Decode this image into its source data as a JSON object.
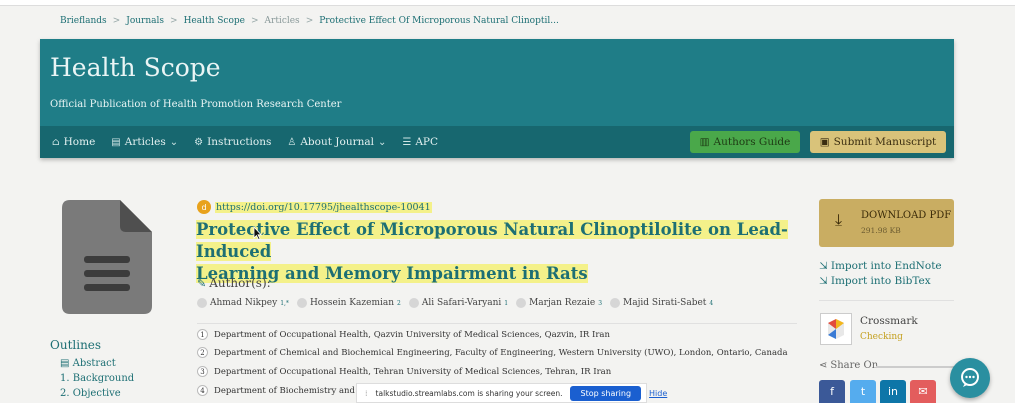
{
  "breadcrumb": [
    {
      "label": "Brieflands",
      "muted": false
    },
    {
      "label": "Journals",
      "muted": false
    },
    {
      "label": "Health Scope",
      "muted": false
    },
    {
      "label": "Articles",
      "muted": true
    },
    {
      "label": "Protective Effect Of Microporous Natural Clinoptil...",
      "muted": false
    }
  ],
  "breadcrumb_sep": ">",
  "journal": {
    "title": "Health Scope",
    "subtitle": "Official Publication of Health Promotion Research Center"
  },
  "nav": {
    "items": [
      {
        "label": "Home",
        "icon": "home-icon",
        "glyph": "⌂"
      },
      {
        "label": "Articles",
        "icon": "book-icon",
        "glyph": "▤",
        "dropdown": true
      },
      {
        "label": "Instructions",
        "icon": "gears-icon",
        "glyph": "⚙"
      },
      {
        "label": "About Journal",
        "icon": "person-icon",
        "glyph": "♙",
        "dropdown": true
      },
      {
        "label": "APC",
        "icon": "list-icon",
        "glyph": "☰"
      }
    ],
    "authors_guide": "Authors Guide",
    "submit_manuscript": "Submit Manuscript"
  },
  "article": {
    "doi": "https://doi.org/10.17795/jhealthscope-10041",
    "doi_badge": "d",
    "title_line1": "Protective Effect of Microporous Natural Clinoptilolite on Lead-Induced",
    "title_line2": "Learning and Memory Impairment in Rats",
    "authors_label": "Author(s):",
    "authors": [
      {
        "name": "Ahmad Nikpey",
        "sup": "1,*"
      },
      {
        "name": "Hossein Kazemian",
        "sup": "2"
      },
      {
        "name": "Ali Safari-Varyani",
        "sup": "1"
      },
      {
        "name": "Marjan Rezaie",
        "sup": "3"
      },
      {
        "name": "Majid Sirati-Sabet",
        "sup": "4"
      }
    ],
    "affiliations": [
      {
        "num": "1",
        "text": "Department of Occupational Health, Qazvin University of Medical Sciences, Qazvin, IR Iran"
      },
      {
        "num": "2",
        "text": "Department of Chemical and Biochemical Engineering, Faculty of Engineering, Western University (UWO), London, Ontario, Canada"
      },
      {
        "num": "3",
        "text": "Department of Occupational Health, Tehran University of Medical Sciences, Tehran, IR Iran"
      },
      {
        "num": "4",
        "text": "Department of Biochemistry and Ge..."
      }
    ]
  },
  "sidebar_left": {
    "outlines_title": "Outlines",
    "links": [
      "Abstract",
      "1. Background",
      "2. Objective"
    ]
  },
  "sidebar_right": {
    "download_label": "DOWNLOAD PDF",
    "download_size": "291.98 KB",
    "import_endnote": "Import into EndNote",
    "import_bibtex": "Import into BibTex",
    "crossmark_title": "Crossmark",
    "crossmark_status": "Checking",
    "share_on": "Share On",
    "social": [
      {
        "icon": "facebook-icon",
        "glyph": "f",
        "color": "#3b5998"
      },
      {
        "icon": "twitter-icon",
        "glyph": "t",
        "color": "#55acee"
      },
      {
        "icon": "linkedin-icon",
        "glyph": "in",
        "color": "#0e76a8"
      },
      {
        "icon": "email-icon",
        "glyph": "✉",
        "color": "#e35d5d"
      }
    ]
  },
  "screen_share": {
    "message": "talkstudio.streamlabs.com is sharing your screen.",
    "stop": "Stop sharing",
    "hide": "Hide"
  },
  "colors": {
    "banner": "#1f7d87",
    "nav": "#17676f",
    "link": "#1d6f74",
    "highlight": "#f4f18a",
    "guide_button": "#4aa84a",
    "submit_button": "#d9c37a",
    "download_button": "#c9ad62"
  }
}
